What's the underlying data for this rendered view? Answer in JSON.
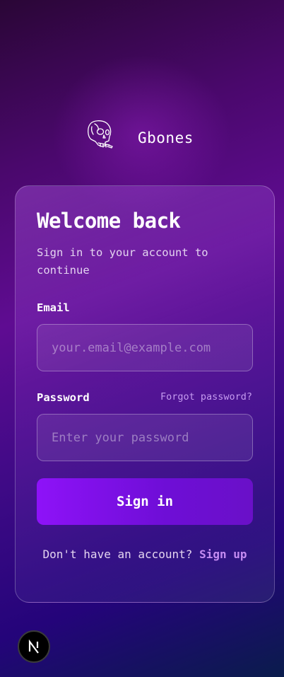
{
  "brand": {
    "name": "Gbones",
    "logo_icon": "skull-icon"
  },
  "card": {
    "title": "Welcome back",
    "subtitle": "Sign in to your account to continue",
    "email": {
      "label": "Email",
      "placeholder": "your.email@example.com",
      "value": ""
    },
    "password": {
      "label": "Password",
      "placeholder": "Enter your password",
      "value": "",
      "forgot_label": "Forgot password?"
    },
    "submit_label": "Sign in",
    "footer": {
      "prompt": "Don't have an account?",
      "link_label": "Sign up"
    }
  },
  "badge": {
    "letter": "N",
    "icon": "nextjs-icon"
  },
  "colors": {
    "accent": "#8e12f8",
    "link": "#c59af0",
    "background_top": "#2a0636",
    "background_bottom": "#0a1c4c"
  }
}
